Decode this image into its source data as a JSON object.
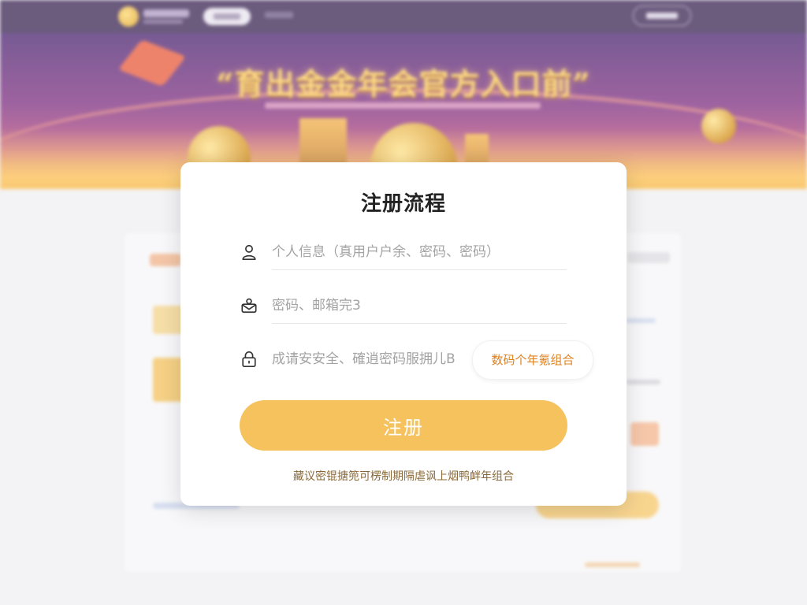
{
  "banner": {
    "title": "“育出金金年会官方入口前”"
  },
  "modal": {
    "title": "注册流程",
    "fields": [
      {
        "icon": "user-icon",
        "placeholder": "个人信息（真用户户余、密码、密码）"
      },
      {
        "icon": "mail-icon",
        "placeholder": "密码、邮箱完3"
      },
      {
        "icon": "lock-icon",
        "placeholder": "成请安安全、確逍密码服拥儿B"
      }
    ],
    "password_tag": "数码个年氪组合",
    "submit_label": "注册",
    "hint": "藏议密锟搪篼可楞制期隔虐讽上烟鸭衅年组合"
  },
  "colors": {
    "accent": "#f6c25d",
    "tag_text": "#e0801d",
    "banner_title": "#ffcf5a"
  }
}
